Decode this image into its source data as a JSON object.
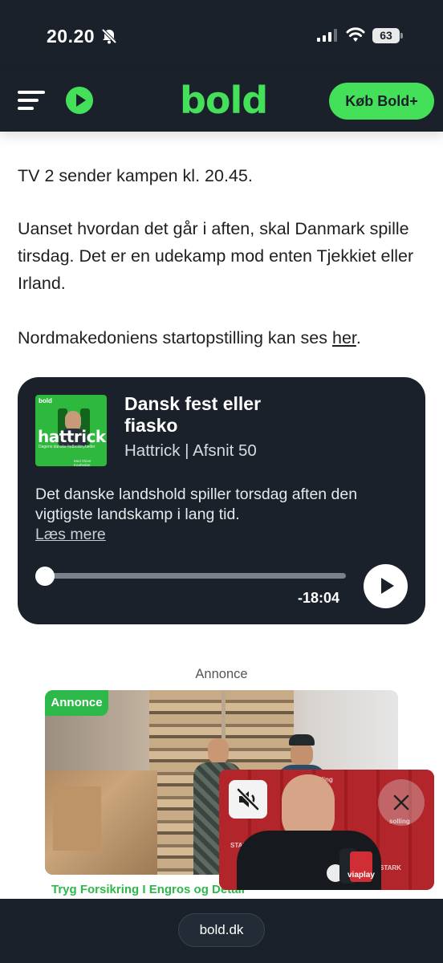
{
  "status_bar": {
    "time": "20.20",
    "battery": "63"
  },
  "header": {
    "logo": "bold",
    "buy_button": "Køb Bold+"
  },
  "article": {
    "p1": "TV 2 sender kampen kl. 20.45.",
    "p2": "Uanset hvordan det går i aften, skal Danmark spille tirsdag. Det er en udekamp mod enten Tjekkiet eller Irland.",
    "p3_prefix": "Nordmakedoniens startopstilling kan ses ",
    "p3_link": "her",
    "p3_suffix": "."
  },
  "podcast": {
    "cover_brand": "bold",
    "cover_title": "hattrick",
    "cover_subtitle": "Dagens danske fodboldnyheder",
    "cover_host": "Med Oliver Kouhedge",
    "title": "Dansk fest eller fiasko",
    "subtitle": "Hattrick | Afsnit 50",
    "description": "Det danske landshold spiller torsdag aften den vigtigste landskamp i lang tid.",
    "read_more": "Læs mere",
    "remaining": "-18:04",
    "progress": 0.0
  },
  "ad": {
    "label": "Annonce",
    "badge": "Annonce",
    "caption": "Tryg Forsikring I  Engros og Detail"
  },
  "video": {
    "sponsor": "solling",
    "sponsor_2": "STARK",
    "broadcaster": "viaplay"
  },
  "bottom": {
    "url": "bold.dk"
  },
  "colors": {
    "brand_green": "#45e05a",
    "dark": "#1a212b",
    "ad_green": "#2db84a"
  }
}
